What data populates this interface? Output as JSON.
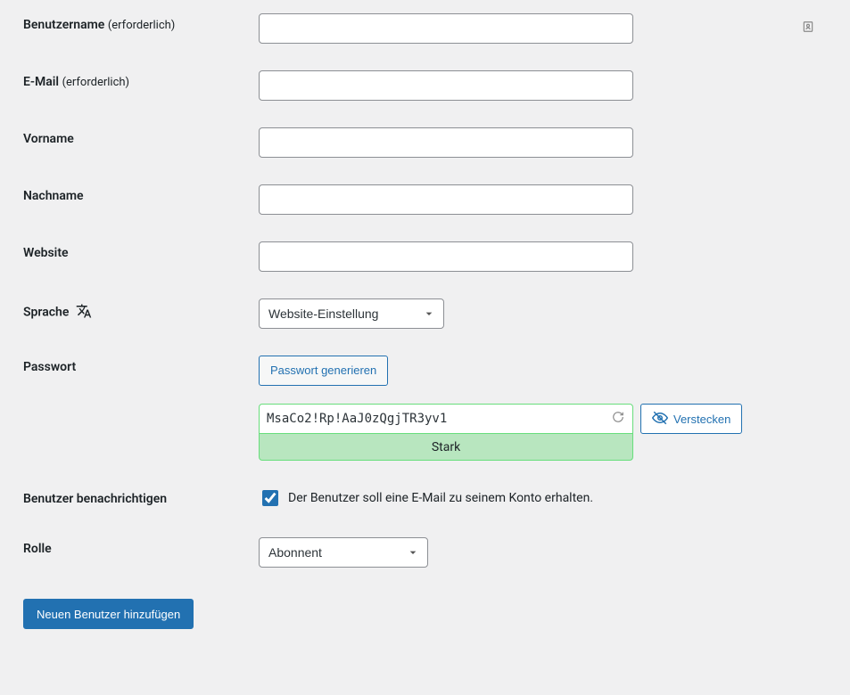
{
  "fields": {
    "username": {
      "label": "Benutzername",
      "required_text": "(erforderlich)",
      "value": ""
    },
    "email": {
      "label": "E-Mail",
      "required_text": "(erforderlich)",
      "value": ""
    },
    "firstname": {
      "label": "Vorname",
      "value": ""
    },
    "lastname": {
      "label": "Nachname",
      "value": ""
    },
    "website": {
      "label": "Website",
      "value": ""
    }
  },
  "language": {
    "label": "Sprache",
    "selected": "Website-Einstellung"
  },
  "password": {
    "label": "Passwort",
    "generate_label": "Passwort generieren",
    "value": "MsaCo2!Rp!AaJ0zQgjTR3yv1",
    "strength_label": "Stark",
    "hide_label": "Verstecken"
  },
  "notify": {
    "label": "Benutzer benachrichtigen",
    "checkbox_label": "Der Benutzer soll eine E-Mail zu seinem Konto erhalten.",
    "checked": true
  },
  "role": {
    "label": "Rolle",
    "selected": "Abonnent"
  },
  "submit": {
    "label": "Neuen Benutzer hinzufügen"
  }
}
